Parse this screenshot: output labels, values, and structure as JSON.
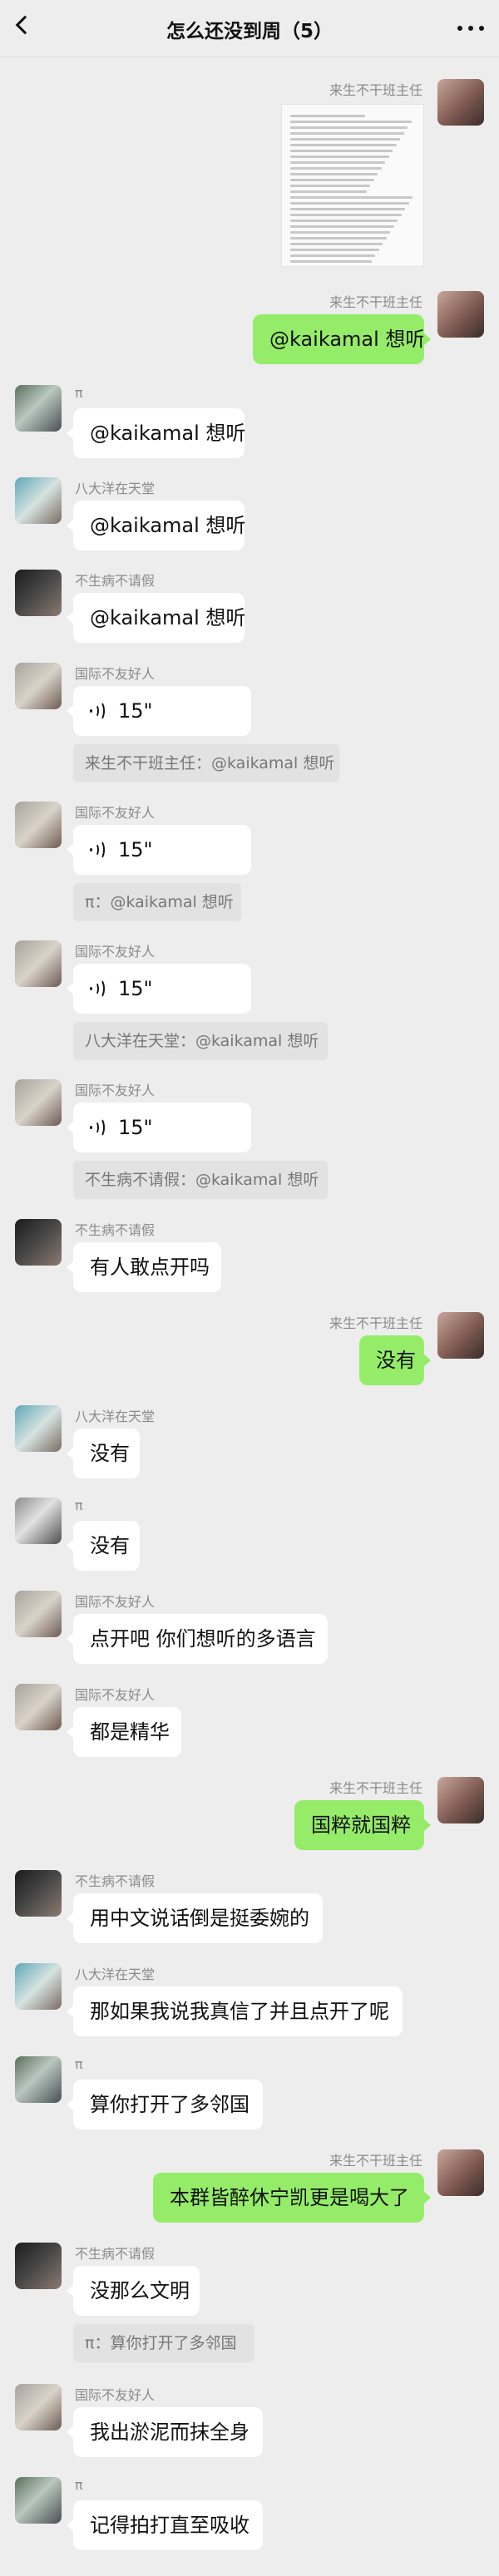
{
  "header": {
    "title": "怎么还没到周（5）"
  },
  "messages": [
    {
      "id": "m1",
      "side": "right",
      "sender": "来生不干班主任",
      "type": "image",
      "avatar": "a"
    },
    {
      "id": "m2",
      "side": "right",
      "sender": "来生不干班主任",
      "type": "text",
      "text": "@kaikamal 想听",
      "avatar": "a"
    },
    {
      "id": "m3",
      "side": "left",
      "sender": "π",
      "type": "text",
      "text": "@kaikamal 想听",
      "avatar": "b"
    },
    {
      "id": "m4",
      "side": "left",
      "sender": "八大洋在天堂",
      "type": "text",
      "text": "@kaikamal 想听",
      "avatar": "c"
    },
    {
      "id": "m5",
      "side": "left",
      "sender": "不生病不请假",
      "type": "text",
      "text": "@kaikamal 想听",
      "avatar": "d"
    },
    {
      "id": "m6",
      "side": "left",
      "sender": "国际不友好人",
      "type": "voice",
      "text": "15\"",
      "quote": "来生不干班主任：@kaikamal 想听",
      "avatar": "e"
    },
    {
      "id": "m7",
      "side": "left",
      "sender": "国际不友好人",
      "type": "voice",
      "text": "15\"",
      "quote": "π：@kaikamal 想听",
      "avatar": "e"
    },
    {
      "id": "m8",
      "side": "left",
      "sender": "国际不友好人",
      "type": "voice",
      "text": "15\"",
      "quote": "八大洋在天堂：@kaikamal 想听",
      "avatar": "e"
    },
    {
      "id": "m9",
      "side": "left",
      "sender": "国际不友好人",
      "type": "voice",
      "text": "15\"",
      "quote": "不生病不请假：@kaikamal 想听",
      "avatar": "e"
    },
    {
      "id": "m10",
      "side": "left",
      "sender": "不生病不请假",
      "type": "text",
      "text": "有人敢点开吗",
      "avatar": "d"
    },
    {
      "id": "m11",
      "side": "right",
      "sender": "来生不干班主任",
      "type": "text",
      "text": "没有",
      "avatar": "a"
    },
    {
      "id": "m12",
      "side": "left",
      "sender": "八大洋在天堂",
      "type": "text",
      "text": "没有",
      "avatar": "c"
    },
    {
      "id": "m13",
      "side": "left",
      "sender": "π",
      "type": "text",
      "text": "没有",
      "avatar": "b"
    },
    {
      "id": "m14",
      "side": "left",
      "sender": "国际不友好人",
      "type": "text",
      "text": "点开吧 你们想听的多语言",
      "avatar": "e"
    },
    {
      "id": "m15",
      "side": "left",
      "sender": "国际不友好人",
      "type": "text",
      "text": "都是精华",
      "avatar": "e"
    },
    {
      "id": "m16",
      "side": "right",
      "sender": "来生不干班主任",
      "type": "text",
      "text": "国粹就国粹",
      "avatar": "a"
    },
    {
      "id": "m17",
      "side": "left",
      "sender": "不生病不请假",
      "type": "text",
      "text": "用中文说话倒是挺委婉的",
      "avatar": "d"
    },
    {
      "id": "m18",
      "side": "left",
      "sender": "八大洋在天堂",
      "type": "text",
      "text": "那如果我说我真信了并且点开了呢",
      "avatar": "c"
    },
    {
      "id": "m19",
      "side": "left",
      "sender": "π",
      "type": "text",
      "text": "算你打开了多邻国",
      "avatar": "b"
    },
    {
      "id": "m20",
      "side": "right",
      "sender": "来生不干班主任",
      "type": "text",
      "text": "本群皆醉休宁凯更是喝大了",
      "avatar": "a"
    },
    {
      "id": "m21",
      "side": "left",
      "sender": "不生病不请假",
      "type": "text",
      "text": "没那么文明",
      "quote": "π：算你打开了多邻国",
      "avatar": "d"
    },
    {
      "id": "m22",
      "side": "left",
      "sender": "国际不友好人",
      "type": "text",
      "text": "我出淤泥而抹全身",
      "avatar": "e"
    },
    {
      "id": "m23",
      "side": "left",
      "sender": "π",
      "type": "text",
      "text": "记得拍打直至吸收",
      "avatar": "b"
    }
  ]
}
